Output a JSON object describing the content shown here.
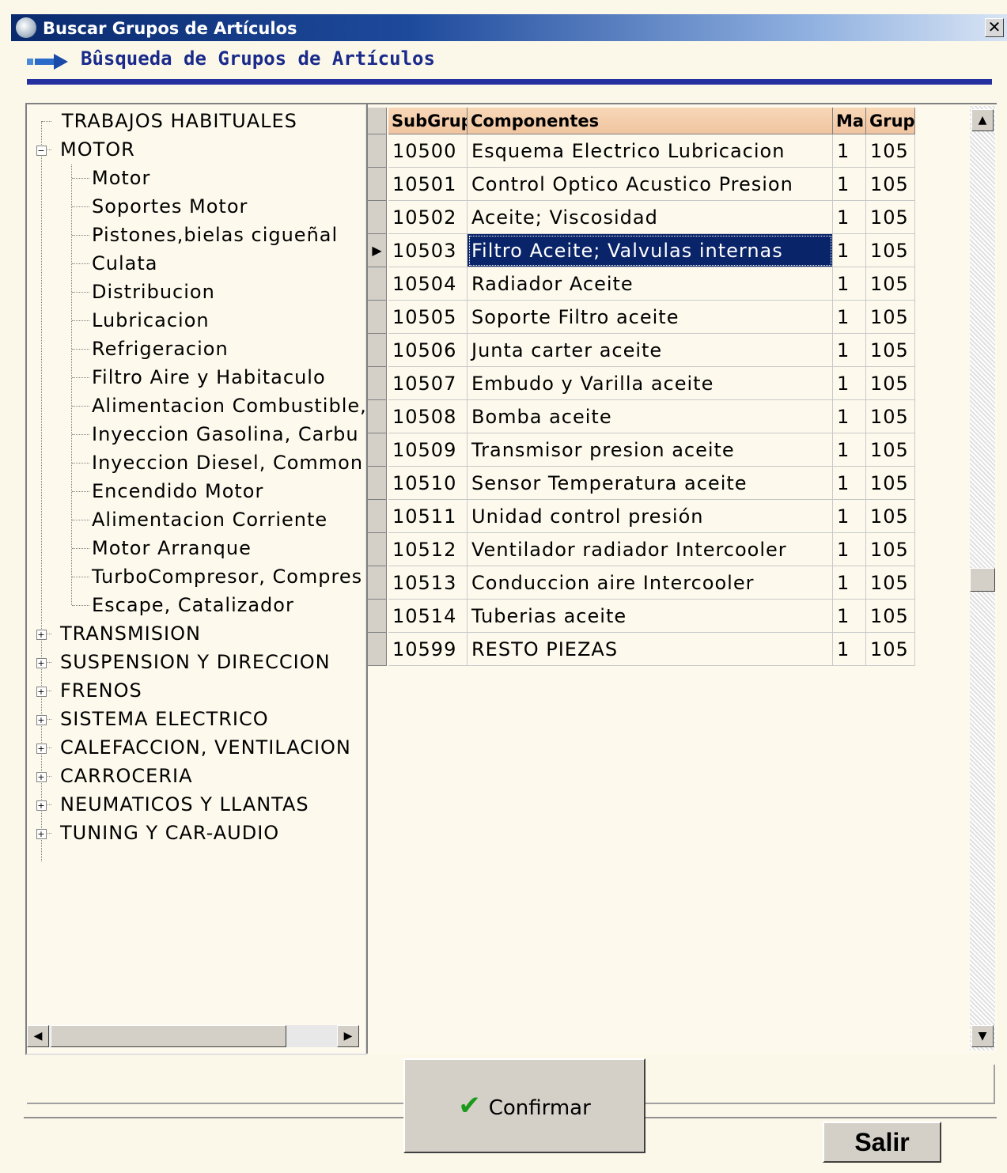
{
  "window": {
    "title": "Buscar Grupos de Artículos",
    "close_glyph": "✕"
  },
  "header": {
    "title": "Bûsqueda de Grupos de Artículos"
  },
  "tree": {
    "top_item": "TRABAJOS HABITUALES",
    "expanded": {
      "label": "MOTOR",
      "expander": "−",
      "children": [
        "Motor",
        "Soportes Motor",
        "Pistones,bielas cigueñal",
        "Culata",
        "Distribucion",
        "Lubricacion",
        "Refrigeracion",
        "Filtro Aire y Habitaculo",
        "Alimentacion Combustible,",
        "Inyeccion Gasolina, Carbu",
        "Inyeccion Diesel, Common",
        "Encendido Motor",
        "Alimentacion Corriente",
        "Motor Arranque",
        "TurboCompresor, Compres",
        "Escape, Catalizador"
      ]
    },
    "collapsed": [
      "TRANSMISION",
      "SUSPENSION Y DIRECCION",
      "FRENOS",
      "SISTEMA ELECTRICO",
      "CALEFACCION, VENTILACION",
      "CARROCERIA",
      "NEUMATICOS Y LLANTAS",
      "TUNING Y CAR-AUDIO"
    ],
    "collapsed_expander": "+"
  },
  "grid": {
    "columns": [
      "SubGrup",
      "Componentes",
      "Ma",
      "Grup"
    ],
    "selected_row": 3,
    "row_pointer": "▶",
    "rows": [
      [
        "10500",
        "Esquema Electrico Lubricacion",
        "1",
        "105"
      ],
      [
        "10501",
        "Control Optico Acustico Presion",
        "1",
        "105"
      ],
      [
        "10502",
        "Aceite; Viscosidad",
        "1",
        "105"
      ],
      [
        "10503",
        "Filtro Aceite; Valvulas internas",
        "1",
        "105"
      ],
      [
        "10504",
        "Radiador Aceite",
        "1",
        "105"
      ],
      [
        "10505",
        "Soporte Filtro aceite",
        "1",
        "105"
      ],
      [
        "10506",
        "Junta carter aceite",
        "1",
        "105"
      ],
      [
        "10507",
        "Embudo y Varilla aceite",
        "1",
        "105"
      ],
      [
        "10508",
        "Bomba aceite",
        "1",
        "105"
      ],
      [
        "10509",
        "Transmisor presion aceite",
        "1",
        "105"
      ],
      [
        "10510",
        "Sensor Temperatura aceite",
        "1",
        "105"
      ],
      [
        "10511",
        "Unidad control presión",
        "1",
        "105"
      ],
      [
        "10512",
        "Ventilador radiador Intercooler",
        "1",
        "105"
      ],
      [
        "10513",
        "Conduccion aire Intercooler",
        "1",
        "105"
      ],
      [
        "10514",
        "Tuberias aceite",
        "1",
        "105"
      ],
      [
        "10599",
        "RESTO PIEZAS",
        "1",
        "105"
      ]
    ]
  },
  "scroll": {
    "up": "▲",
    "down": "▼",
    "left": "◀",
    "right": "▶"
  },
  "buttons": {
    "confirm_label": "Confirmar",
    "confirm_icon": "✔",
    "exit_label": "Salir"
  },
  "colors": {
    "title_gradient_start": "#0a2a6e",
    "selection": "#0a246a",
    "header_bg": "#f0c4a0",
    "accent_line": "#2430a0",
    "check": "#1a9a1a"
  }
}
